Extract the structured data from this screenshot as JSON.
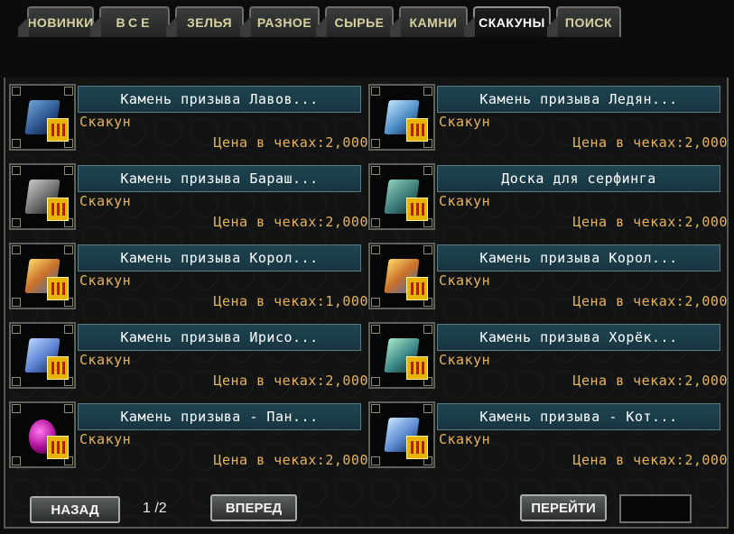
{
  "tabs": [
    {
      "label": "НОВИНКИ"
    },
    {
      "label": "ВСЕ"
    },
    {
      "label": "ЗЕЛЬЯ"
    },
    {
      "label": "РАЗНОЕ"
    },
    {
      "label": "СЫРЬЕ"
    },
    {
      "label": "КАМНИ"
    },
    {
      "label": "СКАКУНЫ",
      "active": true
    },
    {
      "label": "ПОИСК"
    }
  ],
  "items": [
    {
      "name": "Камень призыва Лавов...",
      "category": "Скакун",
      "price": "Цена в чеках:2,000",
      "icon": "blue-summon-stone-icon"
    },
    {
      "name": "Камень призыва Ледян...",
      "category": "Скакун",
      "price": "Цена в чеках:2,000",
      "icon": "blue-summon-stone-icon"
    },
    {
      "name": "Камень призыва Бараш...",
      "category": "Скакун",
      "price": "Цена в чеках:2,000",
      "icon": "grey-summon-stone-icon"
    },
    {
      "name": "Доска для серфинга",
      "category": "Скакун",
      "price": "Цена в чеках:2,000",
      "icon": "surfboard-icon"
    },
    {
      "name": "Камень призыва Корол...",
      "category": "Скакун",
      "price": "Цена в чеках:1,000",
      "icon": "gold-summon-stone-icon"
    },
    {
      "name": "Камень призыва Корол...",
      "category": "Скакун",
      "price": "Цена в чеках:2,000",
      "icon": "gold-summon-stone-icon"
    },
    {
      "name": "Камень призыва Ирисо...",
      "category": "Скакун",
      "price": "Цена в чеках:2,000",
      "icon": "blue-summon-stone-icon"
    },
    {
      "name": "Камень призыва Хорёк...",
      "category": "Скакун",
      "price": "Цена в чеках:2,000",
      "icon": "teal-summon-stone-icon"
    },
    {
      "name": "Камень призыва - Пан...",
      "category": "Скакун",
      "price": "Цена в чеках:2,000",
      "icon": "purple-egg-icon"
    },
    {
      "name": "Камень призыва - Кот...",
      "category": "Скакун",
      "price": "Цена в чеках:2,000",
      "icon": "blue-summon-stone-icon"
    }
  ],
  "pagination": {
    "back_label": "НАЗАД",
    "page_text": "1 /2",
    "next_label": "ВПЕРЕД",
    "goto_label": "ПЕРЕЙТИ",
    "goto_value": ""
  },
  "colors": {
    "accent_gold": "#e8b45a",
    "name_bar": "#1f4552",
    "badge": "#e8b400"
  }
}
